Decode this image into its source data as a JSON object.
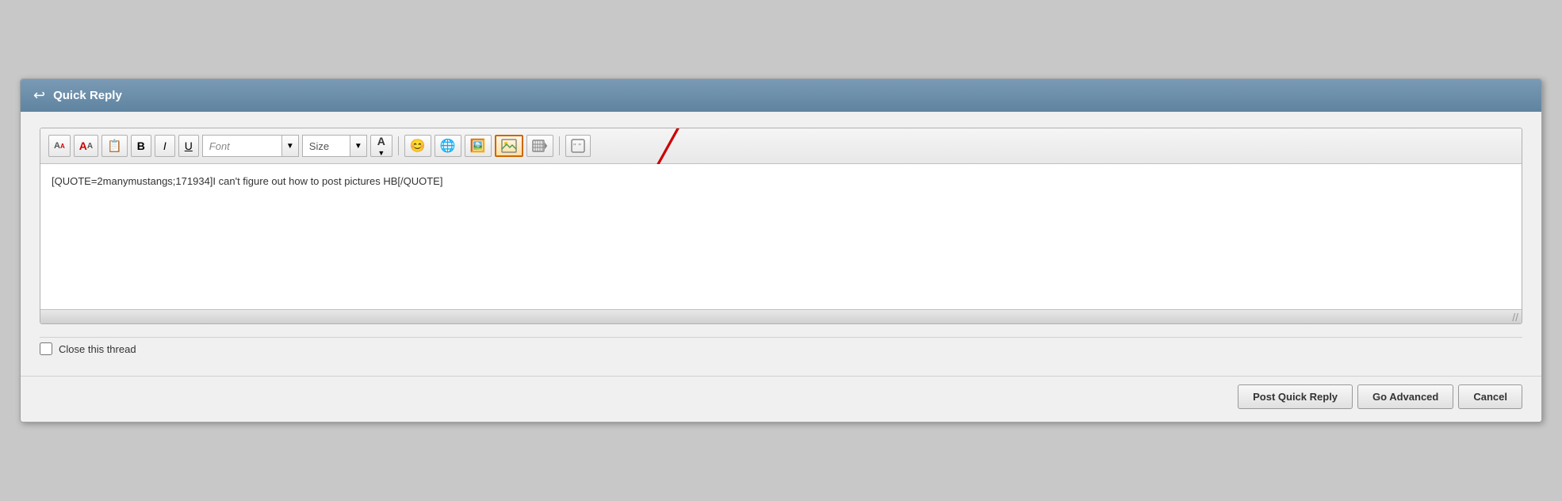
{
  "titlebar": {
    "title": "Quick Reply",
    "back_icon": "↩"
  },
  "toolbar": {
    "font_label": "Font",
    "font_placeholder": "Font",
    "size_label": "Size",
    "buttons": [
      {
        "name": "decrease-font",
        "label": "A",
        "sub": "A"
      },
      {
        "name": "increase-font",
        "label": "A",
        "sub": "A"
      },
      {
        "name": "paste-image",
        "label": "📋"
      },
      {
        "name": "bold",
        "label": "B"
      },
      {
        "name": "italic",
        "label": "I"
      },
      {
        "name": "underline",
        "label": "U"
      },
      {
        "name": "font-color",
        "label": "A"
      },
      {
        "name": "emoji",
        "label": "😊"
      },
      {
        "name": "link",
        "label": "🌐"
      },
      {
        "name": "image",
        "label": "🖼"
      },
      {
        "name": "insert-image",
        "label": "⊞"
      },
      {
        "name": "video",
        "label": "▣"
      },
      {
        "name": "quote",
        "label": "💬"
      }
    ]
  },
  "editor": {
    "content": "[QUOTE=2manymustangs;171934]I can't figure out how to post pictures HB[/QUOTE]",
    "placeholder": ""
  },
  "close_thread": {
    "label": "Close this thread"
  },
  "footer": {
    "post_btn": "Post Quick Reply",
    "advanced_btn": "Go Advanced",
    "cancel_btn": "Cancel"
  }
}
